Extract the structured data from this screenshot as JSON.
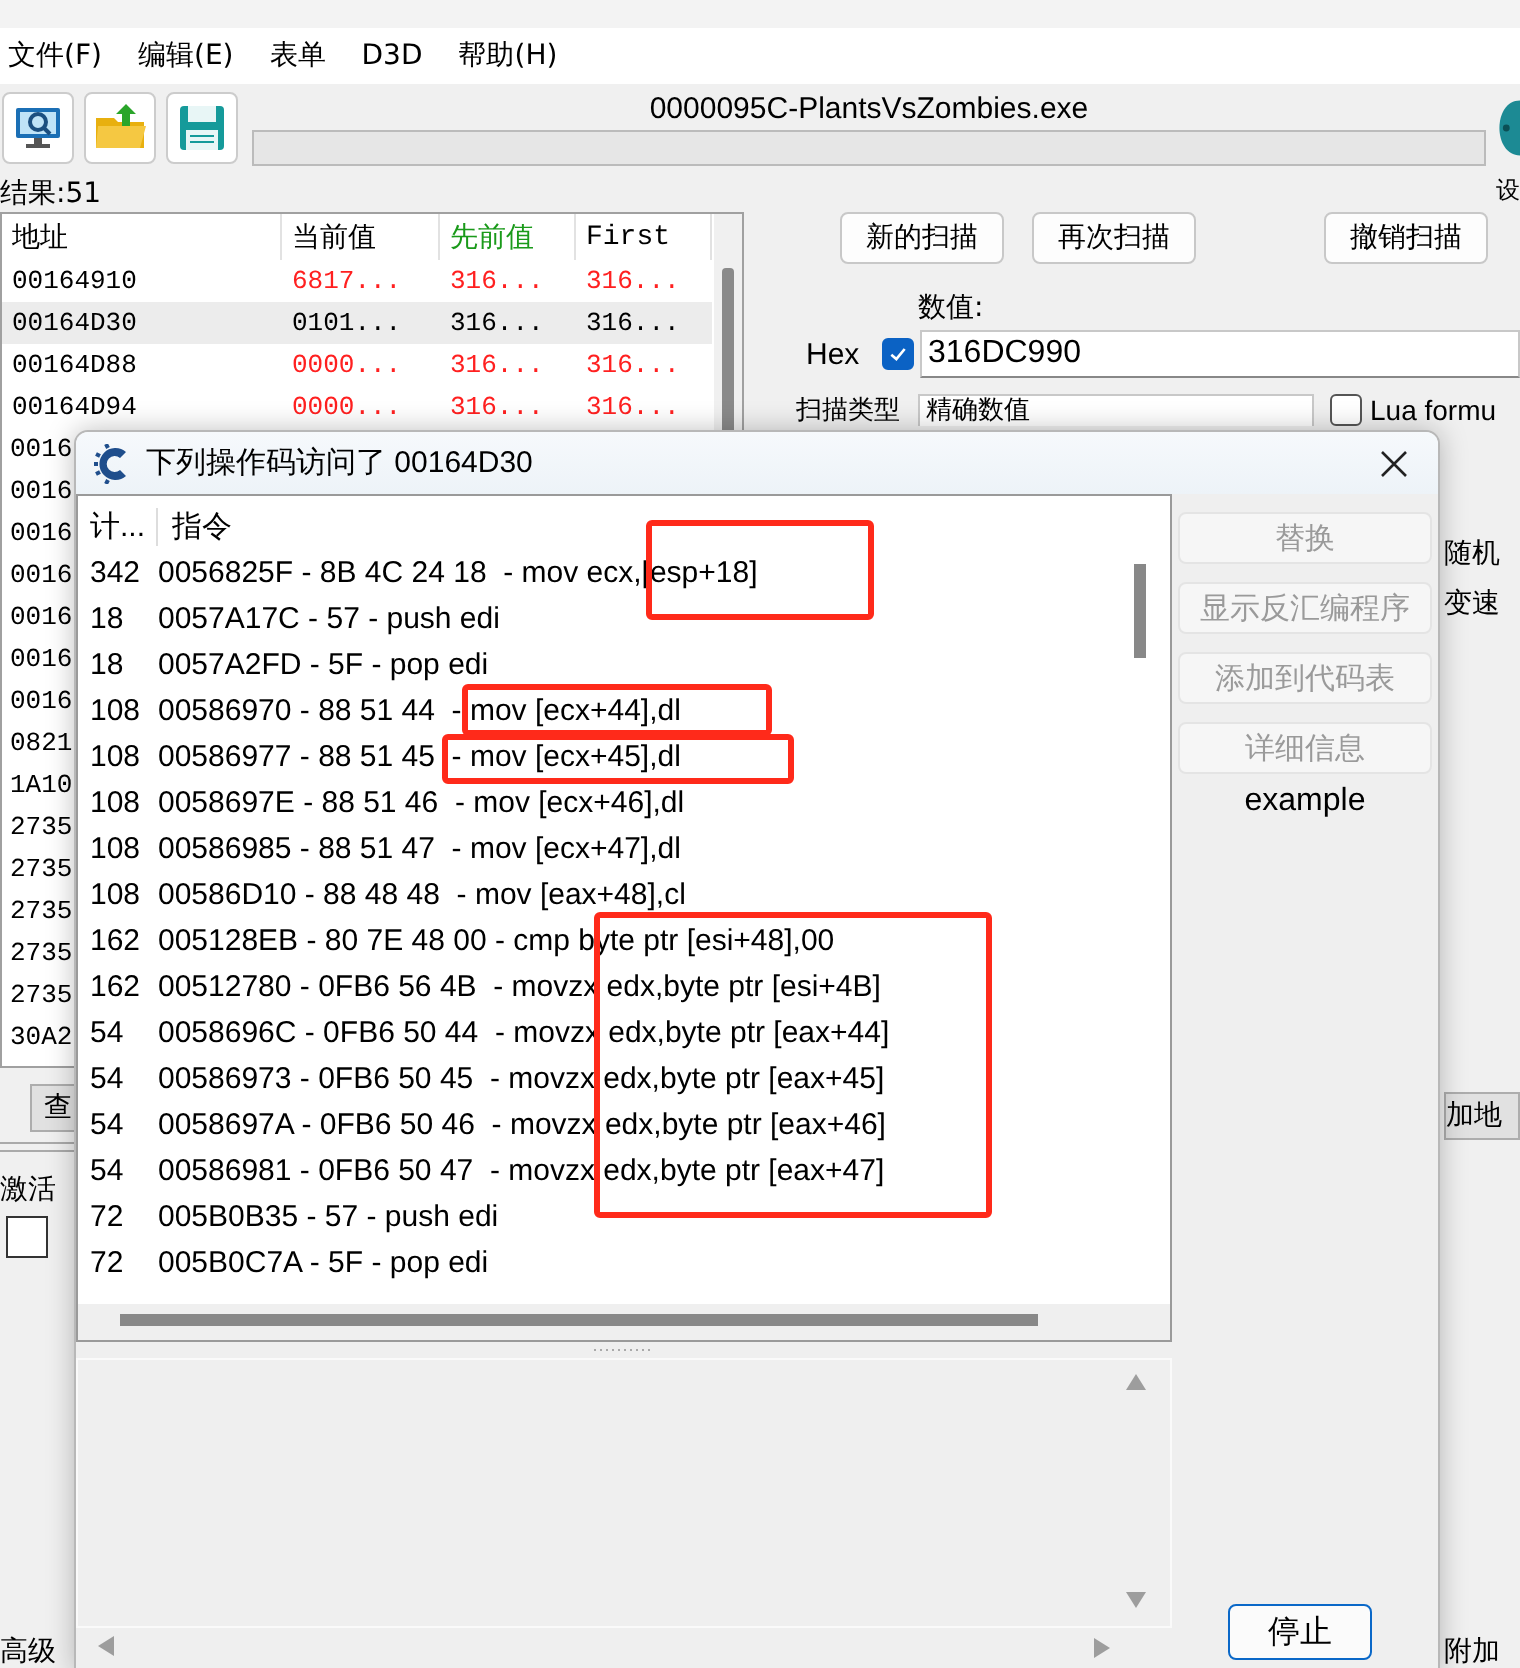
{
  "menu": [
    "文件(F)",
    "编辑(E)",
    "表单",
    "D3D",
    "帮助(H)"
  ],
  "process_title": "0000095C-PlantsVsZombies.exe",
  "progress": {
    "level": 0
  },
  "logo_caption": "设",
  "results": {
    "label": "结果:51",
    "columns": [
      {
        "label": "地址",
        "highlighted": false
      },
      {
        "label": "当前值",
        "highlighted": false
      },
      {
        "label": "先前值",
        "highlighted": true
      },
      {
        "label": "First",
        "highlighted": false
      }
    ],
    "rows": [
      {
        "address": "00164910",
        "value": "6817...",
        "previous": "316...",
        "first": "316...",
        "changed": true,
        "selected": false
      },
      {
        "address": "00164D30",
        "value": "0101...",
        "previous": "316...",
        "first": "316...",
        "changed": false,
        "selected": true
      },
      {
        "address": "00164D88",
        "value": "0000...",
        "previous": "316...",
        "first": "316...",
        "changed": true,
        "selected": false
      },
      {
        "address": "00164D94",
        "value": "0000...",
        "previous": "316...",
        "first": "316...",
        "changed": true,
        "selected": false
      },
      {
        "address": "0016",
        "selected": false
      },
      {
        "address": "0016",
        "selected": false
      },
      {
        "address": "0016",
        "selected": false
      },
      {
        "address": "0016",
        "selected": false
      },
      {
        "address": "0016",
        "selected": false
      },
      {
        "address": "0016",
        "selected": false
      },
      {
        "address": "0016",
        "selected": false
      },
      {
        "address": "0821",
        "selected": false
      },
      {
        "address": "1A10",
        "selected": false
      },
      {
        "address": "2735",
        "selected": false
      },
      {
        "address": "2735",
        "selected": false
      },
      {
        "address": "2735",
        "selected": false
      },
      {
        "address": "2735",
        "selected": false
      },
      {
        "address": "2735",
        "selected": false
      },
      {
        "address": "30A2",
        "selected": false
      }
    ]
  },
  "scan": {
    "buttons": [
      "新的扫描",
      "再次扫描",
      "撤销扫描"
    ],
    "value_label": "数值:",
    "hex": {
      "label": "Hex",
      "checked": true
    },
    "value": "316DC990",
    "type_label": "扫描类型",
    "type": "精确数值",
    "lua": {
      "label": "Lua formu",
      "checked": false
    }
  },
  "options": [
    "随机",
    "变速"
  ],
  "find_button": "查",
  "add_address_button": "加地",
  "activate": {
    "label": "激活",
    "checked": false
  },
  "advanced": "高级",
  "comment": "附加",
  "dialog": {
    "title": "下列操作码访问了 00164D30",
    "columns": [
      "计...",
      "指令"
    ],
    "rows": [
      {
        "count": "342",
        "instruction": "0056825F - 8B 4C 24 18  - mov ecx,[esp+18]",
        "boxed": true,
        "box_start": true
      },
      {
        "count": "18",
        "instruction": "0057A17C - 57 - push edi",
        "boxed": false
      },
      {
        "count": "18",
        "instruction": "0057A2FD - 5F - pop edi",
        "boxed": false
      },
      {
        "count": "108",
        "instruction": "00586970 - 88 51 44  - mov [ecx+44],dl",
        "boxed": true,
        "box_start": true
      },
      {
        "count": "108",
        "instruction": "00586977 - 88 51 45  - mov [ecx+45],dl",
        "boxed": true,
        "box_start": true
      },
      {
        "count": "108",
        "instruction": "0058697E - 88 51 46  - mov [ecx+46],dl",
        "boxed": false
      },
      {
        "count": "108",
        "instruction": "00586985 - 88 51 47  - mov [ecx+47],dl",
        "boxed": false
      },
      {
        "count": "108",
        "instruction": "00586D10 - 88 48 48  - mov [eax+48],cl",
        "boxed": false
      },
      {
        "count": "162",
        "instruction": "005128EB - 80 7E 48 00 - cmp byte ptr [esi+48],00",
        "boxed": true,
        "box_start": true
      },
      {
        "count": "162",
        "instruction": "00512780 - 0FB6 56 4B  - movzx edx,byte ptr [esi+4B]",
        "boxed": true,
        "box_start": false
      },
      {
        "count": "54",
        "instruction": "0058696C - 0FB6 50 44  - movzx edx,byte ptr [eax+44]",
        "boxed": true,
        "box_start": false
      },
      {
        "count": "54",
        "instruction": "00586973 - 0FB6 50 45  - movzx edx,byte ptr [eax+45]",
        "boxed": true,
        "box_start": false
      },
      {
        "count": "54",
        "instruction": "0058697A - 0FB6 50 46  - movzx edx,byte ptr [eax+46]",
        "boxed": true,
        "box_start": false
      },
      {
        "count": "54",
        "instruction": "00586981 - 0FB6 50 47  - movzx edx,byte ptr [eax+47]",
        "boxed": true,
        "box_start": false
      },
      {
        "count": "72",
        "instruction": "005B0B35 - 57 - push edi",
        "boxed": false
      },
      {
        "count": "72",
        "instruction": "005B0C7A - 5F - pop edi",
        "boxed": false
      }
    ],
    "buttons": [
      {
        "label": "替换",
        "disabled": true
      },
      {
        "label": "显示反汇编程序",
        "disabled": true
      },
      {
        "label": "添加到代码表",
        "disabled": true
      },
      {
        "label": "详细信息",
        "disabled": true
      }
    ],
    "note": "example",
    "stop_button": "停止"
  }
}
